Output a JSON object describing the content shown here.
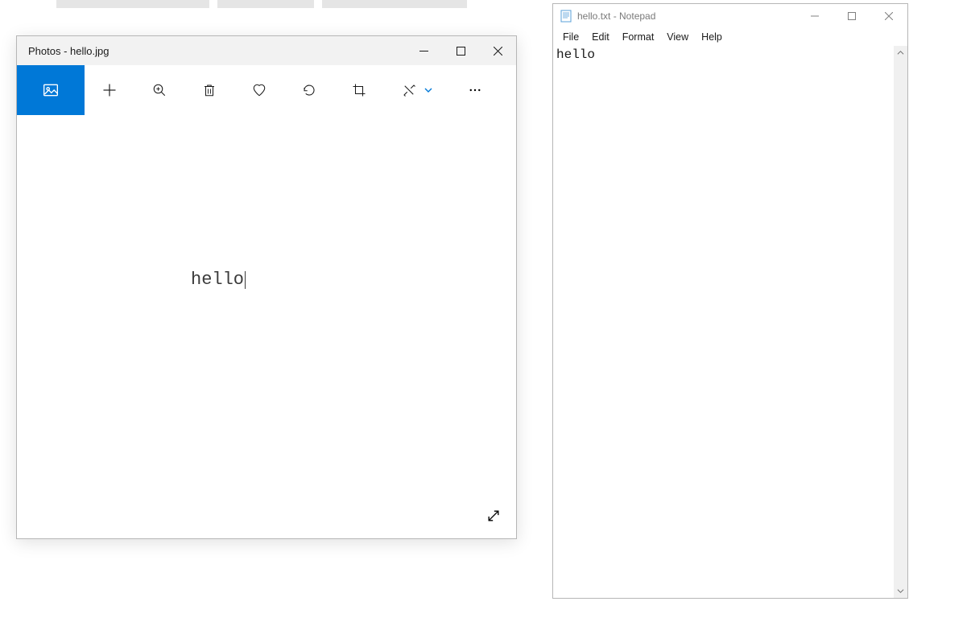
{
  "photos": {
    "title": "Photos - hello.jpg",
    "image_text": "hello",
    "toolbar": {
      "view_collection": "view-collection",
      "add": "add",
      "zoom": "zoom",
      "delete": "delete",
      "favorite": "favorite",
      "rotate": "rotate",
      "crop": "crop",
      "edit": "edit",
      "more": "more"
    }
  },
  "notepad": {
    "title": "hello.txt - Notepad",
    "menu": {
      "file": "File",
      "edit": "Edit",
      "format": "Format",
      "view": "View",
      "help": "Help"
    },
    "content": "hello"
  }
}
